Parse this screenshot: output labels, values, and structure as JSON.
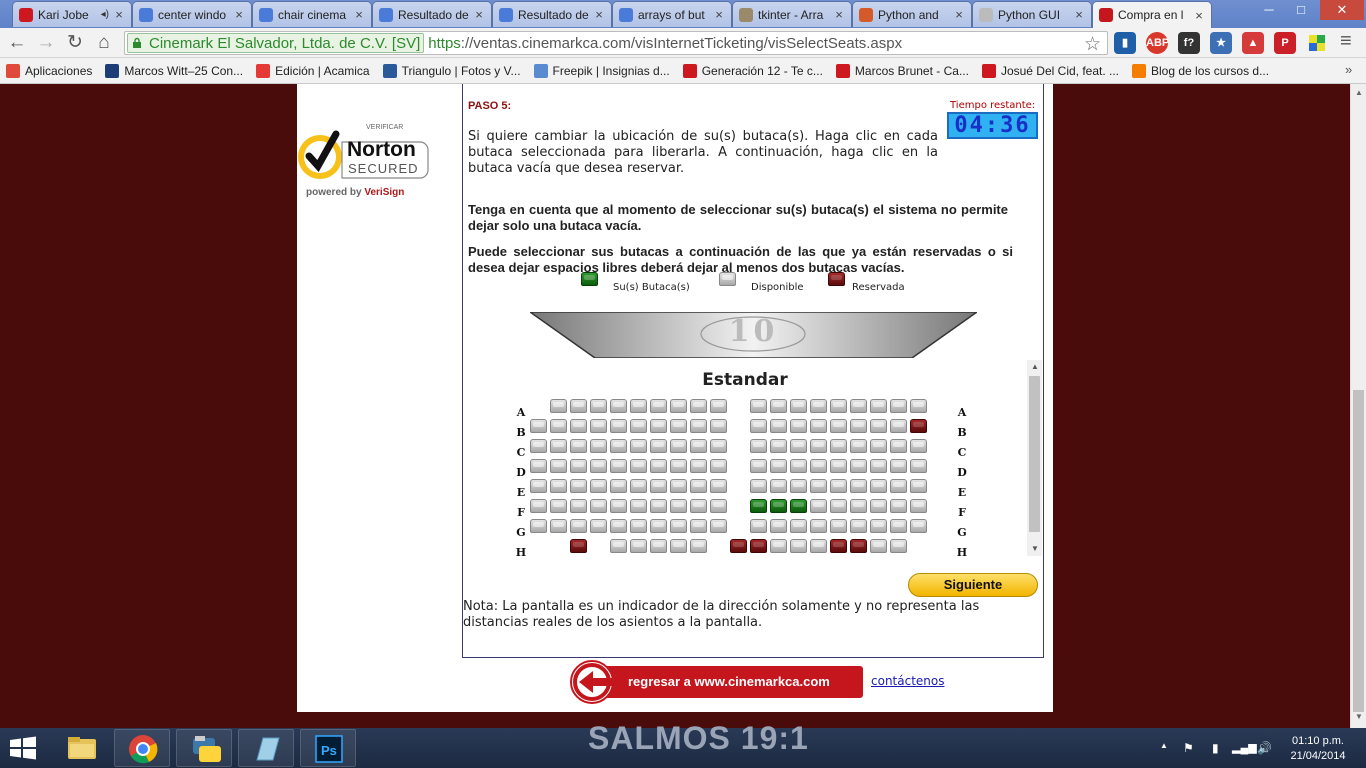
{
  "browser": {
    "tabs": [
      {
        "title": "Kari Jobe",
        "favicon_color": "#cc181e",
        "has_audio": true
      },
      {
        "title": "center windo",
        "favicon_color": "#4a7bd8"
      },
      {
        "title": "chair cinema",
        "favicon_color": "#4a7bd8"
      },
      {
        "title": "Resultado de",
        "favicon_color": "#4a7bd8"
      },
      {
        "title": "Resultado de",
        "favicon_color": "#4a7bd8"
      },
      {
        "title": "arrays of but",
        "favicon_color": "#4a7bd8"
      },
      {
        "title": "tkinter - Arra",
        "favicon_color": "#9a8a6a"
      },
      {
        "title": "Python and",
        "favicon_color": "#d45a2a"
      },
      {
        "title": "Python GUI",
        "favicon_color": "#bbbbbb"
      },
      {
        "title": "Compra en l",
        "favicon_color": "#c4161c",
        "active": true
      }
    ],
    "address": {
      "ev_name": "Cinemark El Salvador, Ltda. de C.V. [SV]",
      "scheme": "https",
      "url_rest": "://ventas.cinemarkca.com/visInternetTicketing/visSelectSeats.aspx"
    },
    "extensions": [
      {
        "label": "ABP",
        "color": "#d8372a"
      },
      {
        "label": "f?",
        "color": "#333333"
      },
      {
        "label": "★",
        "color": "#3d6fb4"
      },
      {
        "label": "▲",
        "color": "#d63b3b"
      },
      {
        "label": "P",
        "color": "#cb2027"
      }
    ],
    "bookmarks": [
      {
        "label": "Aplicaciones",
        "color": "#e04a3a"
      },
      {
        "label": "Marcos Witt–25 Con...",
        "color": "#1e3c78"
      },
      {
        "label": "Edición | Acamica",
        "color": "#e53935"
      },
      {
        "label": "Triangulo | Fotos y V...",
        "color": "#2a5a9a"
      },
      {
        "label": "Freepik | Insignias d...",
        "color": "#5a8ad0"
      },
      {
        "label": "Generación 12 - Te c...",
        "color": "#cc181e"
      },
      {
        "label": "Marcos Brunet - Ca...",
        "color": "#cc181e"
      },
      {
        "label": "Josué Del Cid, feat. ...",
        "color": "#cc181e"
      },
      {
        "label": "Blog de los cursos d...",
        "color": "#f57d00"
      }
    ]
  },
  "norton": {
    "verify": "VERIFICAR",
    "brand": "Norton",
    "secured": "SECURED",
    "powered": "powered by ",
    "verisign": "VeriSign"
  },
  "step": {
    "title": "PASO 5:",
    "timer_label": "Tiempo restante:",
    "timer_value": "04:36",
    "para1": "Si quiere cambiar la ubicación de su(s) butaca(s). Haga clic en cada butaca seleccionada para liberarla. A continuación, haga clic en la butaca vacía que desea reservar.",
    "para2": "Tenga en cuenta que al momento de seleccionar su(s) butaca(s) el sistema no permite dejar solo una butaca vacía.",
    "para3": "Puede seleccionar sus butacas a continuación de las que ya están reservadas o si desea dejar espacios libres deberá dejar al menos dos butacas vacías."
  },
  "legend": {
    "mine": "Su(s) Butaca(s)",
    "available": "Disponible",
    "reserved": "Reservada"
  },
  "screen_number": "10",
  "seatmap": {
    "title": "Estandar",
    "rows": [
      "A",
      "B",
      "C",
      "D",
      "E",
      "F",
      "G",
      "H"
    ],
    "layout": {
      "A": "-.........-.........-",
      "B": "..........-........R",
      "C": "..........-.........",
      "D": "..........-.........",
      "E": "..........-.........",
      "F": "..........-MMM......",
      "G": "..........-.........",
      "H": "--R-.....-RR...RR.."
    }
  },
  "buttons": {
    "next": "Siguiente"
  },
  "note": "Nota: La pantalla es un indicador de la dirección solamente y no representa las distancias reales de los asientos a la pantalla.",
  "footer": {
    "back": "regresar a www.cinemarkca.com",
    "contact": "contáctenos"
  },
  "desktop": {
    "wallpaper_text": "SALMOS 19:1"
  },
  "taskbar": {
    "time": "01:10 p.m.",
    "date": "21/04/2014"
  },
  "colors": {
    "brand_red": "#c4161c",
    "page_bg": "#4a0b0b",
    "seat_mine": "#1b7a1b",
    "seat_reserved": "#7a1414",
    "seat_available": "#c4c4c4",
    "button_yellow": "#f5c400"
  }
}
